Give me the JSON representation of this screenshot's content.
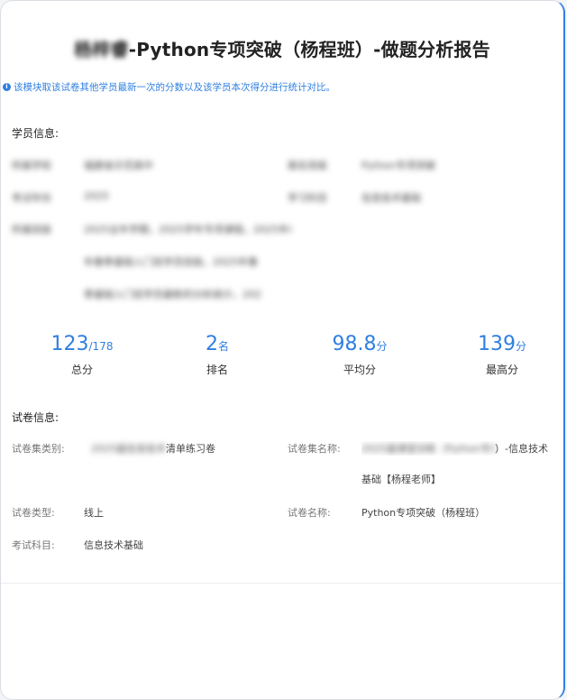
{
  "report": {
    "name_blurred": "杨梓睿",
    "title_suffix": "-Python专项突破（杨程班）-做题分析报告",
    "note": "该模块取该试卷其他学员最新一次的分数以及该学员本次得分进行统计对比。"
  },
  "student": {
    "section_label": "学员信息:",
    "fields": [
      {
        "label": "所属学校",
        "value": "福建省示范高中"
      },
      {
        "label": "报名班级",
        "value": "Python专项突破"
      },
      {
        "label": "考试年份",
        "value": "2025"
      },
      {
        "label": "学习科目",
        "value": "信息技术基础"
      },
      {
        "label": "所属班级",
        "value": "2025全年学期，2025学年专项课程，2025年春季基础入门班学员"
      }
    ],
    "extra_lines": [
      "年春季基础入门班学员班级，2025年春",
      "季基础入门班学员最新的分析统计，202"
    ]
  },
  "stats": [
    {
      "value": "123",
      "unit": "/178",
      "label": "总分"
    },
    {
      "value": "2",
      "unit": "名",
      "label": "排名"
    },
    {
      "value": "98.8",
      "unit": "分",
      "label": "平均分"
    },
    {
      "value": "139",
      "unit": "分",
      "label": "最高分"
    }
  ],
  "exam": {
    "section_label": "试卷信息:",
    "set_type_label": "试卷集类别:",
    "set_type_blurred": "2025届信息技术",
    "set_type_visible": "清单练习卷",
    "set_name_label": "试卷集名称:",
    "set_name_blurred": "2025届课堂训练（Python专项突破",
    "set_name_visible": "）-信息技术",
    "set_name_line2": "基础【杨程老师】",
    "type_label": "试卷类型:",
    "type_value": "线上",
    "name_label": "试卷名称:",
    "name_value": "Python专项突破（杨程班）",
    "subject_label": "考试科目:",
    "subject_value": "信息技术基础"
  }
}
